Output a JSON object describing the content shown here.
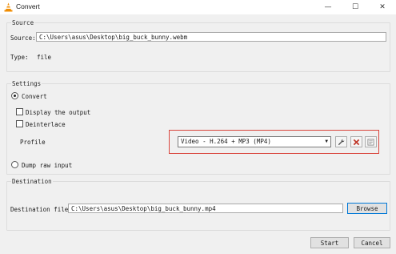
{
  "window": {
    "title": "Convert",
    "minimize": "—",
    "maximize": "☐",
    "close": "✕"
  },
  "source": {
    "group_label": "Source",
    "source_label": "Source:",
    "source_value": "C:\\Users\\asus\\Desktop\\big_buck_bunny.webm",
    "type_label": "Type:",
    "type_value": "file"
  },
  "settings": {
    "group_label": "Settings",
    "convert_label": "Convert",
    "convert_selected": true,
    "display_output_label": "Display the output",
    "display_output_checked": false,
    "deinterlace_label": "Deinterlace",
    "deinterlace_checked": false,
    "profile_label": "Profile",
    "profile_value": "Video - H.264 + MP3 (MP4)",
    "dump_raw_label": "Dump raw input",
    "dump_raw_selected": false
  },
  "destination": {
    "group_label": "Destination",
    "file_label": "Destination file:",
    "file_value": "C:\\Users\\asus\\Desktop\\big_buck_bunny.mp4",
    "browse_label": "Browse"
  },
  "footer": {
    "start_label": "Start",
    "cancel_label": "Cancel"
  },
  "colors": {
    "highlight": "#d9453c",
    "focus_border": "#0078d7",
    "delete_icon": "#c0392b",
    "vlc_orange": "#f08c00"
  },
  "icons": {
    "app": "vlc-cone-icon",
    "edit_profile": "wrench-icon",
    "delete_profile": "delete-x-icon",
    "new_profile": "new-profile-icon"
  }
}
